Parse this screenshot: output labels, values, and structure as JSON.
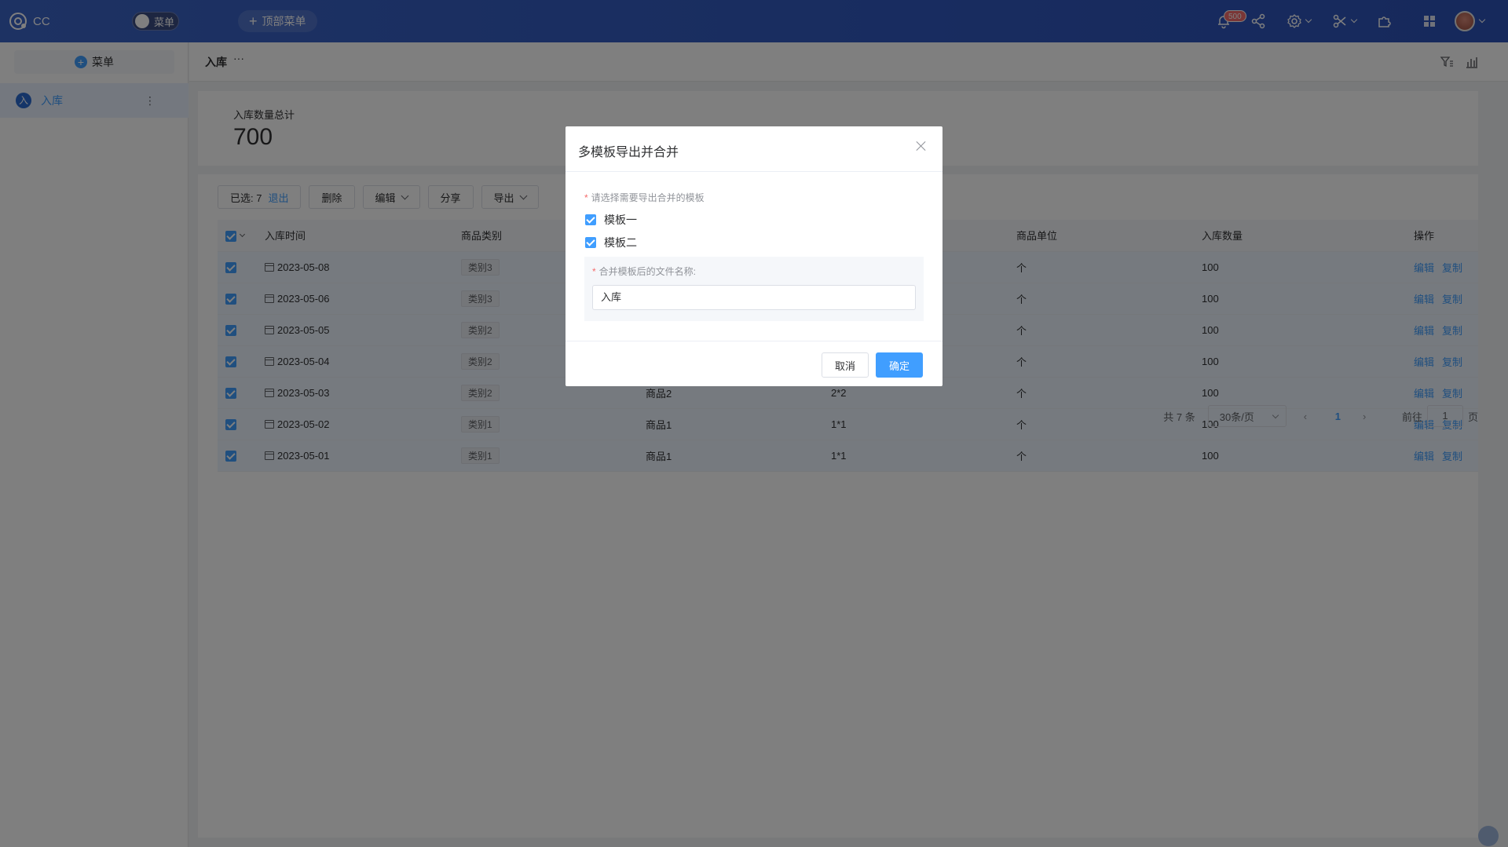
{
  "topbar": {
    "app_name": "CC",
    "menu_toggle_label": "菜单",
    "top_menu_label": "顶部菜单",
    "notification_count": "500",
    "bg_color": "#3159c0"
  },
  "sidebar": {
    "add_menu_label": "菜单",
    "items": [
      {
        "icon_text": "入",
        "label": "入库"
      }
    ]
  },
  "page": {
    "title": "入库",
    "more": "···"
  },
  "stat": {
    "label": "入库数量总计",
    "value": "700"
  },
  "toolbar": {
    "selected_label": "已选: 7",
    "exit_label": "退出",
    "delete_label": "删除",
    "edit_label": "编辑",
    "share_label": "分享",
    "export_label": "导出"
  },
  "table": {
    "columns": [
      "入库时间",
      "商品类别",
      "",
      "",
      "商品单位",
      "入库数量",
      "操作"
    ],
    "rows": [
      {
        "date": "2023-05-08",
        "category": "类别3",
        "product": "",
        "spec": "",
        "unit": "个",
        "qty": "100"
      },
      {
        "date": "2023-05-06",
        "category": "类别3",
        "product": "",
        "spec": "",
        "unit": "个",
        "qty": "100"
      },
      {
        "date": "2023-05-05",
        "category": "类别2",
        "product": "",
        "spec": "",
        "unit": "个",
        "qty": "100"
      },
      {
        "date": "2023-05-04",
        "category": "类别2",
        "product": "",
        "spec": "",
        "unit": "个",
        "qty": "100"
      },
      {
        "date": "2023-05-03",
        "category": "类别2",
        "product": "商品2",
        "spec": "2*2",
        "unit": "个",
        "qty": "100"
      },
      {
        "date": "2023-05-02",
        "category": "类别1",
        "product": "商品1",
        "spec": "1*1",
        "unit": "个",
        "qty": "100"
      },
      {
        "date": "2023-05-01",
        "category": "类别1",
        "product": "商品1",
        "spec": "1*1",
        "unit": "个",
        "qty": "100"
      }
    ],
    "op_edit": "编辑",
    "op_copy": "复制"
  },
  "pager": {
    "total": "共 7 条",
    "page_size": "30条/页",
    "current": "1",
    "goto_label": "前往",
    "goto_value": "1",
    "page_suffix": "页"
  },
  "dialog": {
    "title": "多模板导出并合并",
    "hint": "请选择需要导出合并的模板",
    "options": [
      {
        "label": "模板一",
        "checked": true
      },
      {
        "label": "模板二",
        "checked": true
      }
    ],
    "filename_label": "合并模板后的文件名称:",
    "filename_value": "入库",
    "cancel_label": "取消",
    "ok_label": "确定"
  }
}
